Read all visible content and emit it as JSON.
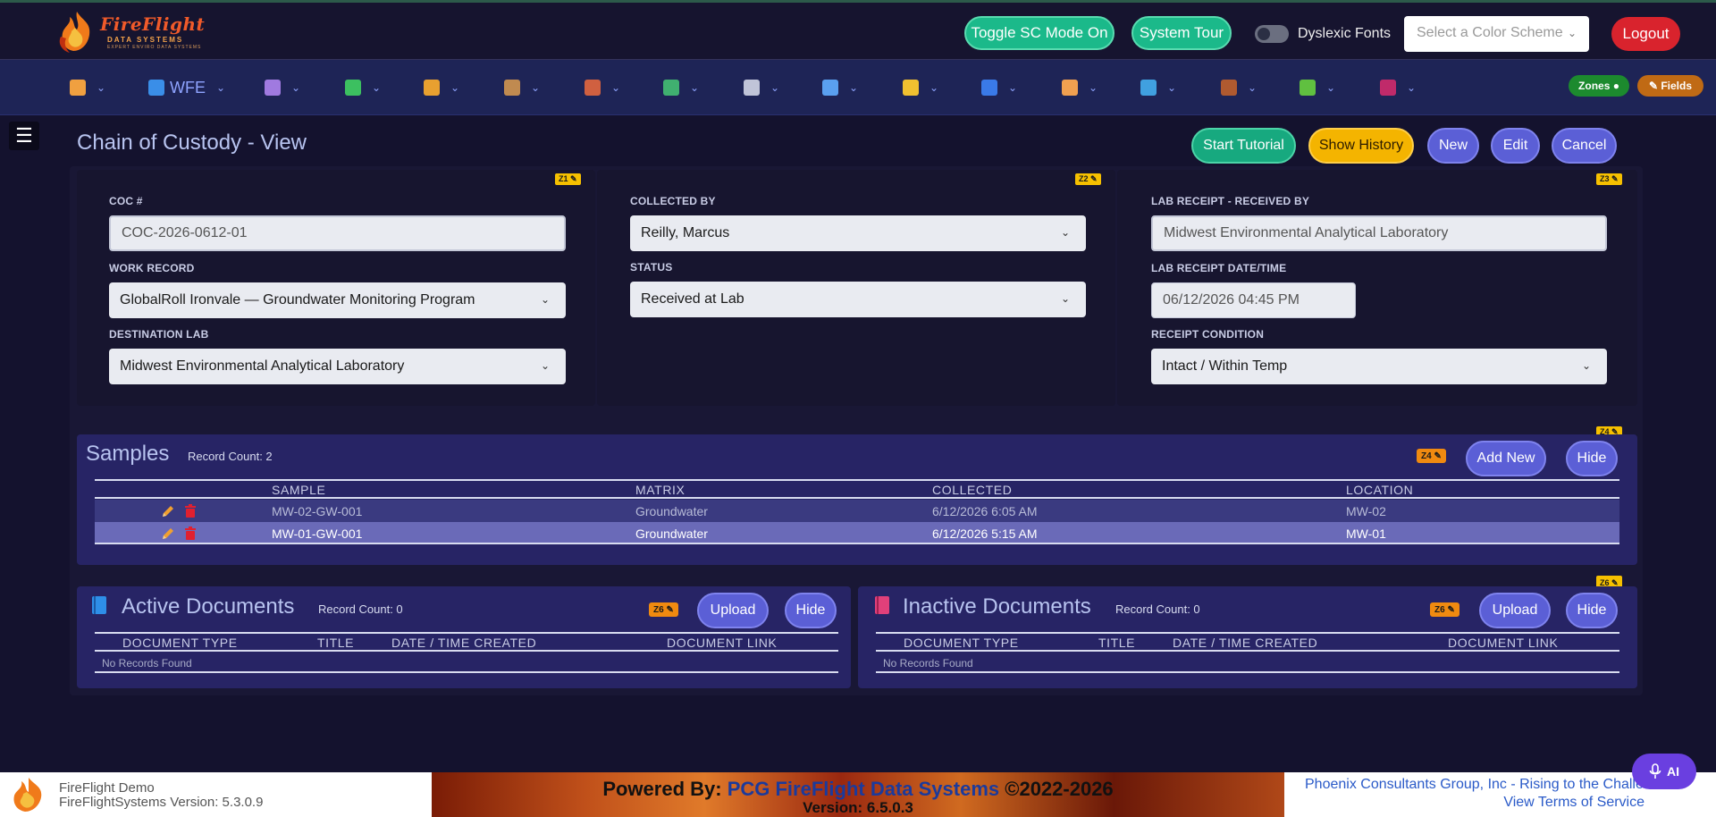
{
  "header": {
    "logo_text": "FireFlight",
    "logo_sub": "DATA SYSTEMS",
    "logo_tagline": "EXPERT ENVIRO DATA SYSTEMS",
    "toggle_sc_label": "Toggle SC Mode On",
    "system_tour_label": "System Tour",
    "dyslexic_label": "Dyslexic Fonts",
    "color_scheme_placeholder": "Select a Color Scheme",
    "logout_label": "Logout"
  },
  "nav": {
    "items": [
      {
        "icon": "home-icon",
        "label": "",
        "color": "#f0a040"
      },
      {
        "icon": "wfe-icon",
        "label": "WFE",
        "color": "#3a8ee8"
      },
      {
        "icon": "form-icon",
        "label": "",
        "color": "#a07ae0"
      },
      {
        "icon": "puzzle-icon",
        "label": "",
        "color": "#3cc060"
      },
      {
        "icon": "truck-icon",
        "label": "",
        "color": "#e8a030"
      },
      {
        "icon": "box-icon",
        "label": "",
        "color": "#c08a50"
      },
      {
        "icon": "brick-icon",
        "label": "",
        "color": "#d06040"
      },
      {
        "icon": "leaf-icon",
        "label": "",
        "color": "#40b070"
      },
      {
        "icon": "document-icon",
        "label": "",
        "color": "#c0c4d8"
      },
      {
        "icon": "search-icon",
        "label": "",
        "color": "#5aa0f0"
      },
      {
        "icon": "lightbulb-icon",
        "label": "",
        "color": "#f0c030"
      },
      {
        "icon": "shield-icon",
        "label": "",
        "color": "#3a7ae8"
      },
      {
        "icon": "hand-icon",
        "label": "",
        "color": "#f0a050"
      },
      {
        "icon": "layers-icon",
        "label": "",
        "color": "#40a0e0"
      },
      {
        "icon": "tree-icon",
        "label": "",
        "color": "#b05a30"
      },
      {
        "icon": "sprout-icon",
        "label": "",
        "color": "#60c040"
      },
      {
        "icon": "virus-icon",
        "label": "",
        "color": "#c02a6a"
      }
    ],
    "zones_label": "Zones ●",
    "fields_label": "✎ Fields"
  },
  "page": {
    "title": "Chain of Custody - View",
    "buttons": {
      "start_tutorial": "Start Tutorial",
      "show_history": "Show History",
      "new": "New",
      "edit": "Edit",
      "cancel": "Cancel"
    }
  },
  "form": {
    "zone_tags": [
      "Z1 ✎",
      "Z2 ✎",
      "Z3 ✎"
    ],
    "coc_label": "COC #",
    "coc_value": "COC-2026-0612-01",
    "work_record_label": "WORK RECORD",
    "work_record_value": "GlobalRoll Ironvale — Groundwater Monitoring Program",
    "destination_lab_label": "DESTINATION LAB",
    "destination_lab_value": "Midwest Environmental Analytical Laboratory",
    "collected_by_label": "COLLECTED BY",
    "collected_by_value": "Reilly, Marcus",
    "status_label": "STATUS",
    "status_value": "Received at Lab",
    "lab_received_by_label": "LAB RECEIPT - RECEIVED BY",
    "lab_received_by_value": "Midwest Environmental Analytical Laboratory",
    "lab_receipt_datetime_label": "LAB RECEIPT DATE/TIME",
    "lab_receipt_datetime_value": "06/12/2026 04:45 PM",
    "receipt_condition_label": "RECEIPT CONDITION",
    "receipt_condition_value": "Intact / Within Temp"
  },
  "samples": {
    "title": "Samples",
    "record_count": "Record Count: 2",
    "zone_tag": "Z4 ✎",
    "zone_tag_inline": "Z4 ✎",
    "add_new_label": "Add New",
    "hide_label": "Hide",
    "columns": [
      "SAMPLE",
      "MATRIX",
      "COLLECTED",
      "LOCATION"
    ],
    "rows": [
      {
        "sample": "MW-02-GW-001",
        "matrix": "Groundwater",
        "collected": "6/12/2026 6:05 AM",
        "location": "MW-02"
      },
      {
        "sample": "MW-01-GW-001",
        "matrix": "Groundwater",
        "collected": "6/12/2026 5:15 AM",
        "location": "MW-01"
      }
    ]
  },
  "active_docs": {
    "title": "Active Documents",
    "record_count": "Record Count: 0",
    "zone_tag": "Z6 ✎",
    "upload_label": "Upload",
    "hide_label": "Hide",
    "columns": [
      "DOCUMENT TYPE",
      "TITLE",
      "DATE / TIME CREATED",
      "DOCUMENT LINK"
    ],
    "empty_text": "No Records Found"
  },
  "inactive_docs": {
    "title": "Inactive Documents",
    "record_count": "Record Count: 0",
    "zone_tag": "Z6 ✎",
    "corner_tag": "Z6 ✎",
    "upload_label": "Upload",
    "hide_label": "Hide",
    "columns": [
      "DOCUMENT TYPE",
      "TITLE",
      "DATE / TIME CREATED",
      "DOCUMENT LINK"
    ],
    "empty_text": "No Records Found"
  },
  "footer": {
    "app_name": "FireFlight Demo",
    "app_version": "FireFlightSystems Version: 5.3.0.9",
    "powered_by_prefix": "Powered By:",
    "powered_by_name": "PCG FireFlight Data Systems",
    "powered_by_suffix": "©2022-2026",
    "version": "Version: 6.5.0.3",
    "company_tagline": "Phoenix Consultants Group, Inc - Rising to the Challe",
    "terms_link": "View Terms of Service"
  },
  "ai_button_label": "AI",
  "hamburger_symbol": "☰"
}
